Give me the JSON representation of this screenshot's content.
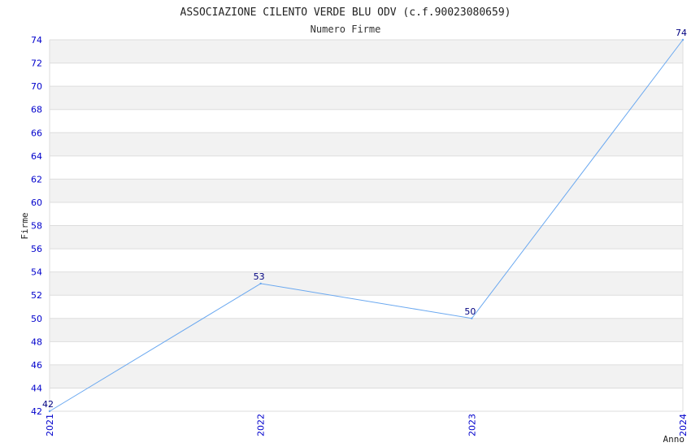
{
  "chart_data": {
    "type": "line",
    "title": "ASSOCIAZIONE CILENTO VERDE BLU ODV (c.f.90023080659)",
    "subtitle": "Numero Firme",
    "xlabel": "Anno",
    "ylabel": "Firme",
    "categories": [
      "2021",
      "2022",
      "2023",
      "2024"
    ],
    "series": [
      {
        "values": [
          42,
          53,
          50,
          74
        ]
      }
    ],
    "ylim": [
      42,
      74
    ],
    "yticks": [
      42,
      44,
      46,
      48,
      50,
      52,
      54,
      56,
      58,
      60,
      62,
      64,
      66,
      68,
      70,
      72,
      74
    ],
    "grid": true,
    "colors": {
      "line": "#6aa8f0",
      "tick_text": "#0000cc",
      "data_label": "#000080",
      "band": "#f2f2f2",
      "grid": "#dddddd"
    }
  }
}
